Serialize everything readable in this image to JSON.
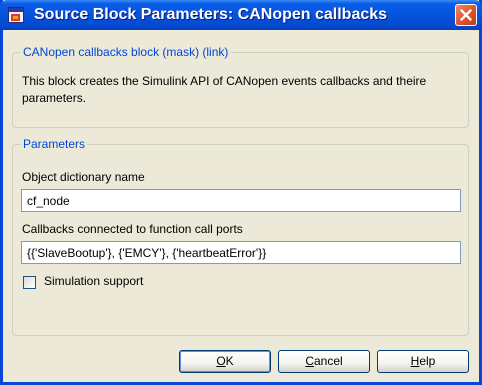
{
  "window": {
    "title": "Source Block Parameters: CANopen callbacks"
  },
  "description": {
    "group_title": "CANopen callbacks block (mask) (link)",
    "text": "This block creates the Simulink API of CANopen events callbacks and theire parameters."
  },
  "parameters": {
    "group_title": "Parameters",
    "object_dictionary_label": "Object dictionary name",
    "object_dictionary_value": "cf_node",
    "callbacks_label": "Callbacks connected to function call ports",
    "callbacks_value": "{{'SlaveBootup'}, {'EMCY'}, {'heartbeatError'}}",
    "simulation_support_label": "Simulation support",
    "simulation_support_checked": false
  },
  "buttons": {
    "ok": {
      "mnemonic": "O",
      "rest": "K"
    },
    "cancel": {
      "mnemonic": "C",
      "rest": "ancel"
    },
    "help": {
      "mnemonic": "H",
      "rest": "elp"
    }
  },
  "colors": {
    "titlebar": "#0654dc",
    "group_title": "#0046d5",
    "dialog_bg": "#ece9d8",
    "close_button": "#e0562f"
  },
  "icons": {
    "app": "simulink-block-icon",
    "close": "close-icon"
  }
}
